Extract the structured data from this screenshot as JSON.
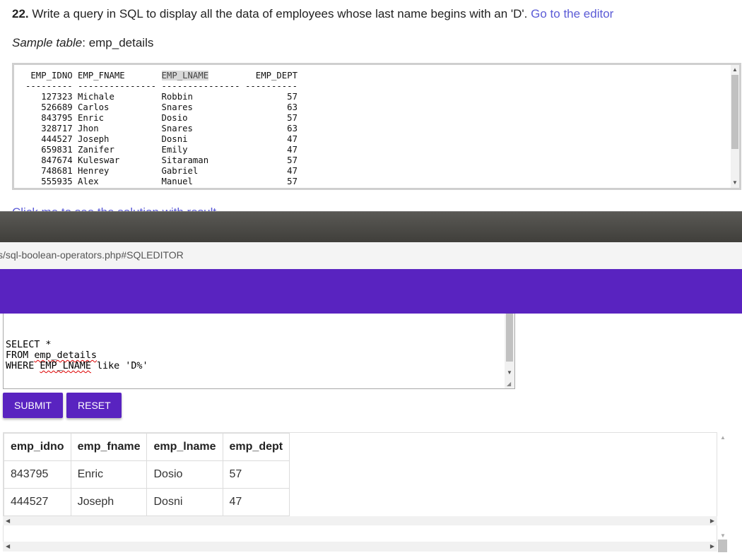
{
  "question": {
    "number": "22.",
    "text": "Write a query in SQL to display all the data of employees whose last name begins with an 'D'.",
    "editor_link": "Go to the editor"
  },
  "sample": {
    "label": "Sample table",
    "table_name": "emp_details",
    "columns": [
      "EMP_IDNO",
      "EMP_FNAME",
      "EMP_LNAME",
      "EMP_DEPT"
    ],
    "rows": [
      [
        "127323",
        "Michale",
        "Robbin",
        "57"
      ],
      [
        "526689",
        "Carlos",
        "Snares",
        "63"
      ],
      [
        "843795",
        "Enric",
        "Dosio",
        "57"
      ],
      [
        "328717",
        "Jhon",
        "Snares",
        "63"
      ],
      [
        "444527",
        "Joseph",
        "Dosni",
        "47"
      ],
      [
        "659831",
        "Zanifer",
        "Emily",
        "47"
      ],
      [
        "847674",
        "Kuleswar",
        "Sitaraman",
        "57"
      ],
      [
        "748681",
        "Henrey",
        "Gabriel",
        "47"
      ],
      [
        "555935",
        "Alex",
        "Manuel",
        "57"
      ]
    ]
  },
  "solution_link": "Click me to see the solution with result",
  "browser": {
    "url": "s/sql-boolean-operators.php#SQLEDITOR"
  },
  "editor": {
    "lines": [
      "SELECT *",
      "FROM emp_details",
      "WHERE EMP_LNAME like 'D%'"
    ]
  },
  "buttons": {
    "submit": "SUBMIT",
    "reset": "RESET"
  },
  "result": {
    "headers": [
      "emp_idno",
      "emp_fname",
      "emp_lname",
      "emp_dept"
    ],
    "rows": [
      [
        "843795",
        "Enric",
        "Dosio",
        "57"
      ],
      [
        "444527",
        "Joseph",
        "Dosni",
        "47"
      ]
    ]
  },
  "colors": {
    "accent": "#5923c0",
    "link": "#5b5bd6"
  }
}
